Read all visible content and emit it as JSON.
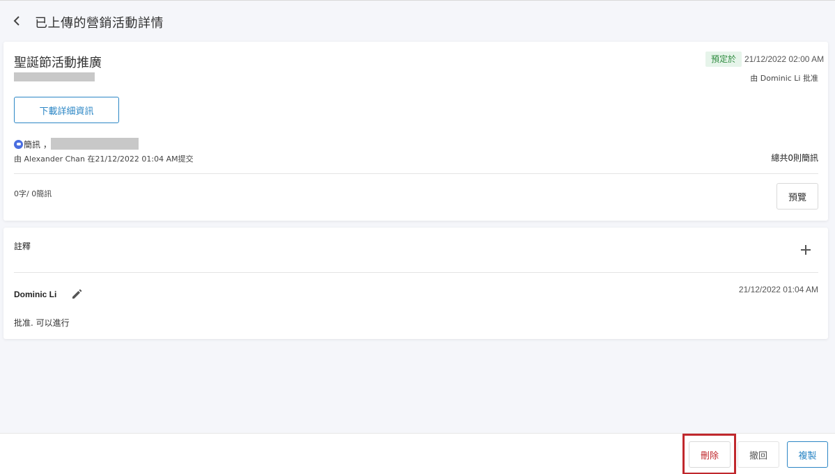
{
  "header": {
    "title": "已上傳的營銷活動詳情"
  },
  "campaign": {
    "name": "聖誕節活動推廣",
    "status_label": "預定於",
    "scheduled_time": "21/12/2022 02:00 AM",
    "approved_by": "由 Dominic Li 批准",
    "download_label": "下載詳細資訊",
    "channel_label": "簡訊 ，",
    "submitted_by": "由 Alexander Chan 在21/12/2022 01:04 AM提交",
    "total_sms": "總共0則簡訊",
    "char_count": "0字/ 0簡訊",
    "preview_label": "預覽"
  },
  "notes": {
    "title": "註釋",
    "items": [
      {
        "author": "Dominic Li",
        "time": "21/12/2022 01:04 AM",
        "text": "批准. 可以進行"
      }
    ]
  },
  "footer": {
    "delete_label": "刪除",
    "revoke_label": "撤回",
    "copy_label": "複製"
  },
  "colors": {
    "accent": "#2b86c5",
    "status_bg": "#e6f4ea",
    "status_text": "#2e8b3e",
    "danger": "#c0282d",
    "sms_icon": "#4a6ee0"
  },
  "icons": {
    "back": "chevron-left-icon",
    "sms": "sms-icon",
    "add": "plus-icon",
    "edit": "pencil-icon"
  }
}
